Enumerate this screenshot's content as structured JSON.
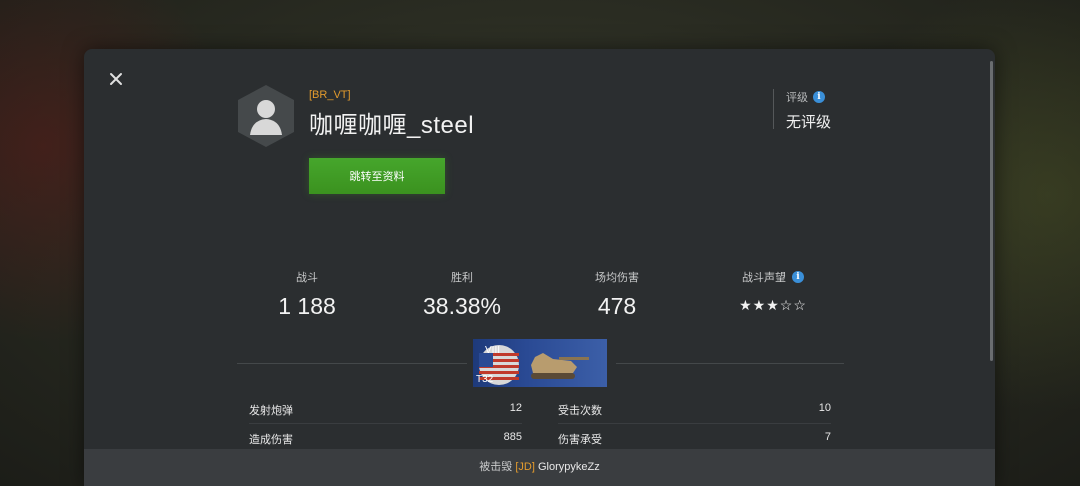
{
  "player": {
    "clan_tag": "[BR_VT]",
    "name": "咖喱咖喱_steel",
    "goto_profile_label": "跳转至资料"
  },
  "rating": {
    "label": "评级",
    "value": "无评级"
  },
  "stats": [
    {
      "label": "战斗",
      "value": "1 188"
    },
    {
      "label": "胜利",
      "value": "38.38%"
    },
    {
      "label": "场均伤害",
      "value": "478"
    },
    {
      "label": "战斗声望",
      "stars_filled": 3,
      "stars_total": 5,
      "stars_text": "★★★☆☆"
    }
  ],
  "tank": {
    "tier": "VIII",
    "name": "T32"
  },
  "battle_details": {
    "left": [
      {
        "label": "发射炮弹",
        "value": "12"
      },
      {
        "label": "造成伤害",
        "value": "885"
      }
    ],
    "right": [
      {
        "label": "受击次数",
        "value": "10"
      },
      {
        "label": "伤害承受",
        "value": "7"
      }
    ]
  },
  "footer": {
    "prefix": "被击毁",
    "killer_tag": "[JD]",
    "killer_name": "GlorypykeZz"
  },
  "icons": {
    "close": "close-icon",
    "info": "info-icon",
    "avatar": "avatar-icon"
  },
  "colors": {
    "accent_orange": "#e39b2d",
    "button_green": "#46a62c",
    "info_blue": "#3a8fd8"
  }
}
